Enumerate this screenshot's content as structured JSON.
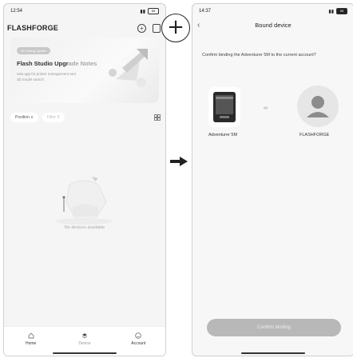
{
  "left_screen": {
    "status": {
      "time": "12:54",
      "battery": "69"
    },
    "app_title": "FLASHFORGE",
    "banner": {
      "badge": "3D Slicing Update",
      "title_bold": "Flash Studio Upgr",
      "title_soft": "ade Notes",
      "description": "new app for printer management and 3D model search"
    },
    "filters": {
      "position": "Position ∨",
      "filter": "Filter ⊽"
    },
    "empty_text": "No devices available",
    "nav": {
      "home": "Home",
      "device": "Device",
      "account": "Account"
    }
  },
  "right_screen": {
    "status": {
      "time": "14:37",
      "battery": "95"
    },
    "title": "Bound device",
    "confirm_question": "Confirm binding the Adventurer 5M to the current account?",
    "printer_name": "Adventurer 5M",
    "user_name": "FLASHFORGE",
    "confirm_button": "Confirm binding"
  },
  "plus_symbol": "+",
  "colors": {
    "accent_gray": "#b8b8b8",
    "background": "#f5f5f5"
  }
}
